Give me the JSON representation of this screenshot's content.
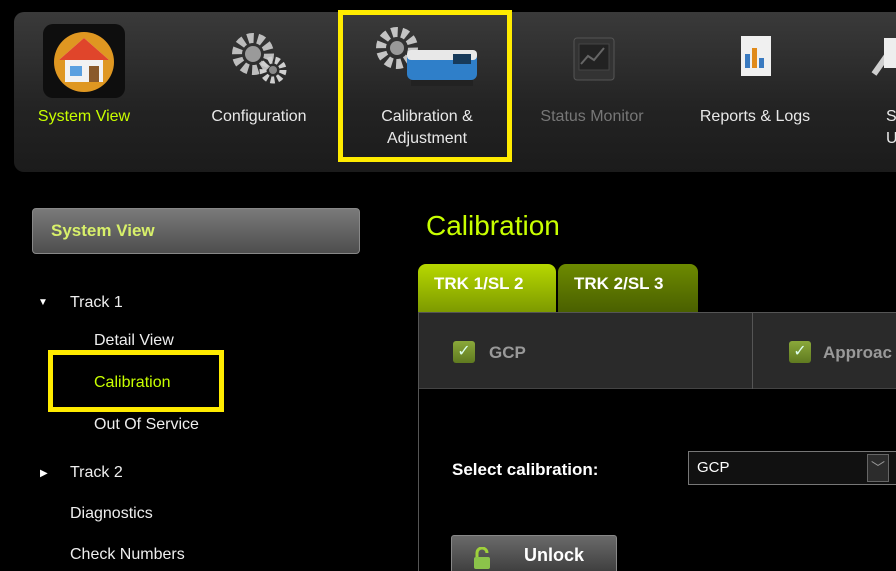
{
  "toolbar": {
    "items": [
      {
        "label": "System View",
        "icon": "house-icon",
        "state": "active"
      },
      {
        "label": "Configuration",
        "icon": "gears-icon",
        "state": "normal"
      },
      {
        "label": "Calibration &\nAdjustment",
        "icon": "gear-train-icon",
        "state": "normal"
      },
      {
        "label": "Status Monitor",
        "icon": "monitor-icon",
        "state": "disabled"
      },
      {
        "label": "Reports & Logs",
        "icon": "report-icon",
        "state": "normal"
      },
      {
        "label": "Sof\nUp",
        "icon": "wrench-icon",
        "state": "normal"
      }
    ]
  },
  "sidebar": {
    "header": "System View",
    "tree": [
      {
        "label": "Track 1",
        "expanded": true
      },
      {
        "label": "Detail View"
      },
      {
        "label": "Calibration",
        "selected": true
      },
      {
        "label": "Out Of Service"
      },
      {
        "label": "Track 2",
        "expanded": false
      },
      {
        "label": "Diagnostics"
      },
      {
        "label": "Check Numbers"
      }
    ]
  },
  "main": {
    "title": "Calibration",
    "tabs": [
      "TRK 1/SL 2",
      "TRK 2/SL 3"
    ],
    "checks": [
      {
        "label": "GCP"
      },
      {
        "label": "Approac"
      }
    ],
    "select_label": "Select calibration:",
    "select_value": "GCP",
    "unlock_label": "Unlock"
  },
  "colors": {
    "accent": "#c8ff00",
    "highlight": "#ffeb00",
    "tab_active": "#a8c800"
  }
}
